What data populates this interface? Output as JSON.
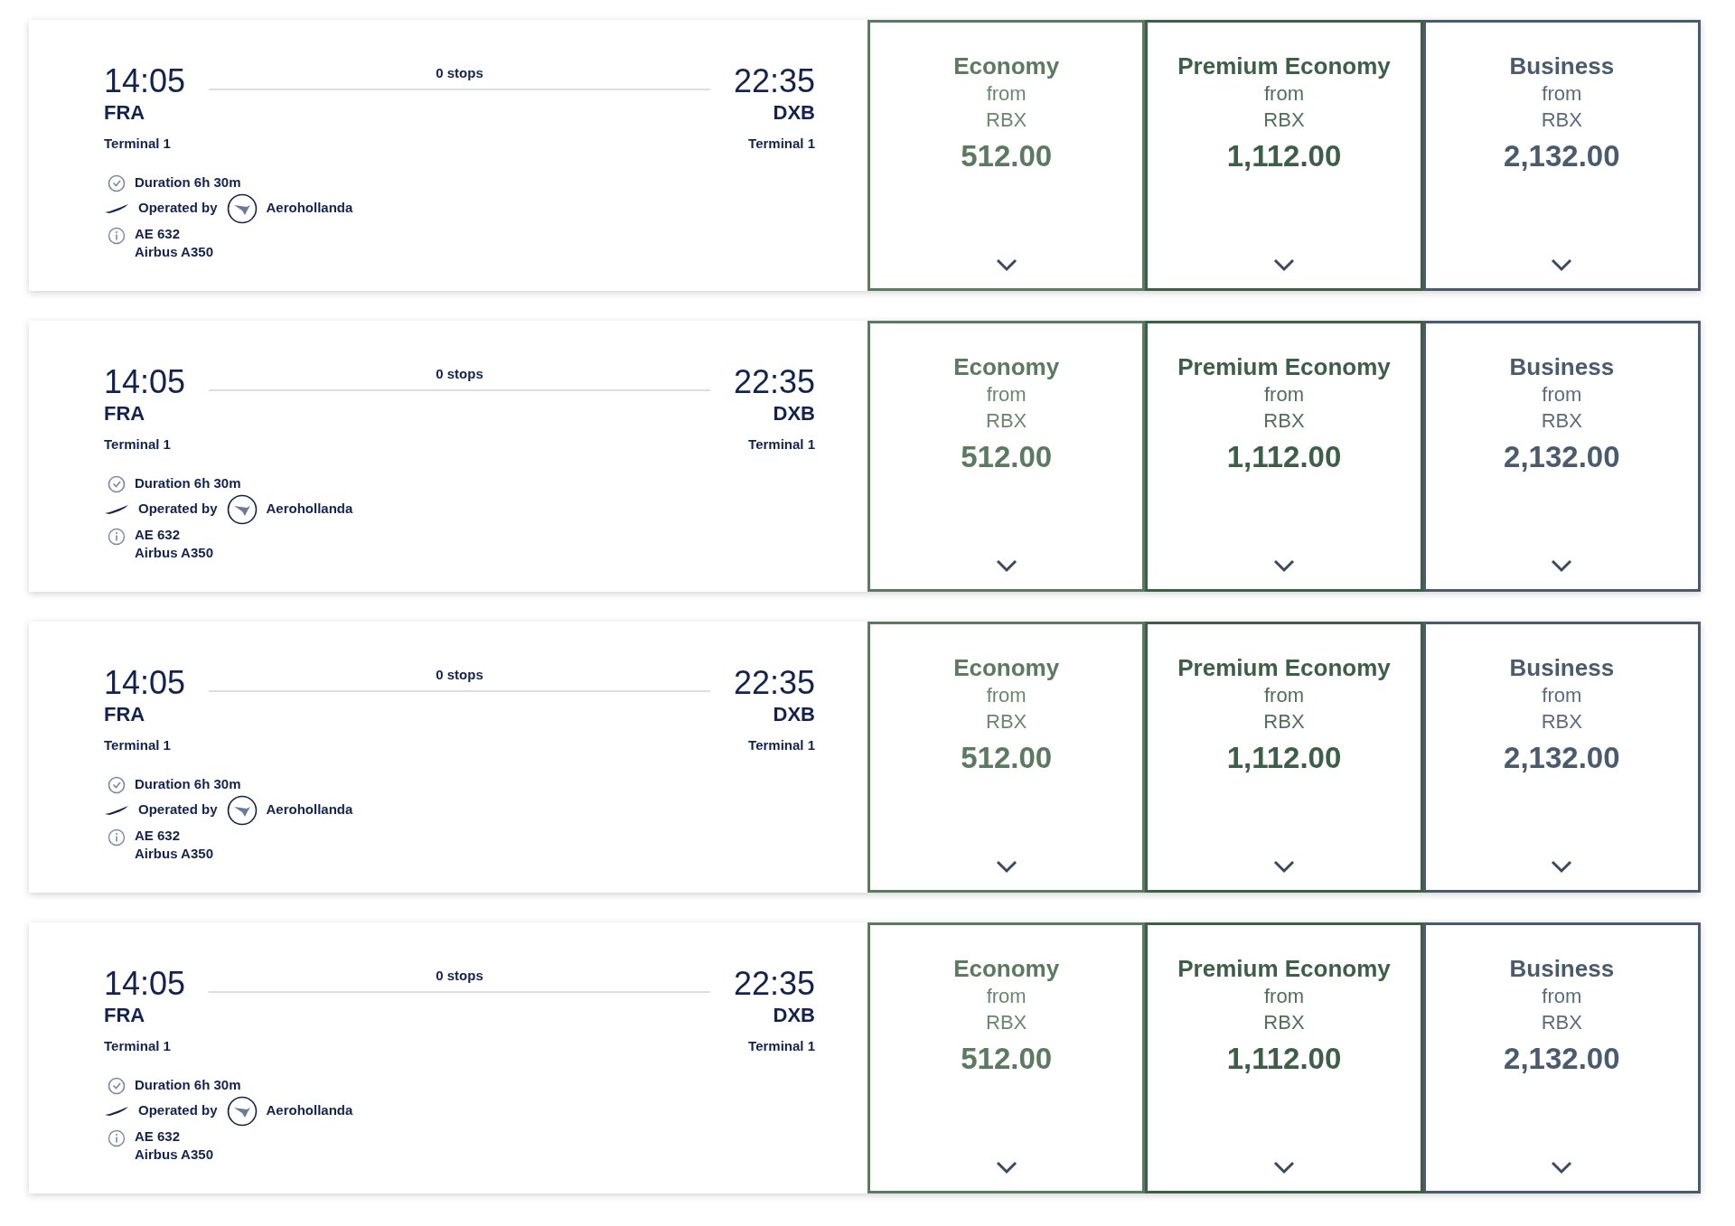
{
  "flights": [
    {
      "departure": {
        "time": "14:05",
        "airport": "FRA",
        "terminal": "Terminal 1"
      },
      "stops": "0 stops",
      "arrival": {
        "time": "22:35",
        "airport": "DXB",
        "terminal": "Terminal 1"
      },
      "duration": "Duration 6h 30m",
      "operated_label": "Operated by",
      "airline": "Aerohollanda",
      "flight_number": "AE 632",
      "aircraft": "Airbus A350",
      "fares": [
        {
          "cabin": "Economy",
          "from": "from",
          "currency": "RBX",
          "price": "512.00",
          "color": "#5b7a5f"
        },
        {
          "cabin": "Premium Economy",
          "from": "from",
          "currency": "RBX",
          "price": "1,112.00",
          "color": "#3e5f47"
        },
        {
          "cabin": "Business",
          "from": "from",
          "currency": "RBX",
          "price": "2,132.00",
          "color": "#4b5b6e"
        }
      ]
    },
    {
      "departure": {
        "time": "14:05",
        "airport": "FRA",
        "terminal": "Terminal 1"
      },
      "stops": "0 stops",
      "arrival": {
        "time": "22:35",
        "airport": "DXB",
        "terminal": "Terminal 1"
      },
      "duration": "Duration 6h 30m",
      "operated_label": "Operated by",
      "airline": "Aerohollanda",
      "flight_number": "AE 632",
      "aircraft": "Airbus A350",
      "fares": [
        {
          "cabin": "Economy",
          "from": "from",
          "currency": "RBX",
          "price": "512.00",
          "color": "#5b7a5f"
        },
        {
          "cabin": "Premium Economy",
          "from": "from",
          "currency": "RBX",
          "price": "1,112.00",
          "color": "#3e5f47"
        },
        {
          "cabin": "Business",
          "from": "from",
          "currency": "RBX",
          "price": "2,132.00",
          "color": "#4b5b6e"
        }
      ]
    },
    {
      "departure": {
        "time": "14:05",
        "airport": "FRA",
        "terminal": "Terminal 1"
      },
      "stops": "0 stops",
      "arrival": {
        "time": "22:35",
        "airport": "DXB",
        "terminal": "Terminal 1"
      },
      "duration": "Duration 6h 30m",
      "operated_label": "Operated by",
      "airline": "Aerohollanda",
      "flight_number": "AE 632",
      "aircraft": "Airbus A350",
      "fares": [
        {
          "cabin": "Economy",
          "from": "from",
          "currency": "RBX",
          "price": "512.00",
          "color": "#5b7a5f"
        },
        {
          "cabin": "Premium Economy",
          "from": "from",
          "currency": "RBX",
          "price": "1,112.00",
          "color": "#3e5f47"
        },
        {
          "cabin": "Business",
          "from": "from",
          "currency": "RBX",
          "price": "2,132.00",
          "color": "#4b5b6e"
        }
      ]
    },
    {
      "departure": {
        "time": "14:05",
        "airport": "FRA",
        "terminal": "Terminal 1"
      },
      "stops": "0 stops",
      "arrival": {
        "time": "22:35",
        "airport": "DXB",
        "terminal": "Terminal 1"
      },
      "duration": "Duration 6h 30m",
      "operated_label": "Operated by",
      "airline": "Aerohollanda",
      "flight_number": "AE 632",
      "aircraft": "Airbus A350",
      "fares": [
        {
          "cabin": "Economy",
          "from": "from",
          "currency": "RBX",
          "price": "512.00",
          "color": "#5b7a5f"
        },
        {
          "cabin": "Premium Economy",
          "from": "from",
          "currency": "RBX",
          "price": "1,112.00",
          "color": "#3e5f47"
        },
        {
          "cabin": "Business",
          "from": "from",
          "currency": "RBX",
          "price": "2,132.00",
          "color": "#4b5b6e"
        }
      ]
    }
  ]
}
